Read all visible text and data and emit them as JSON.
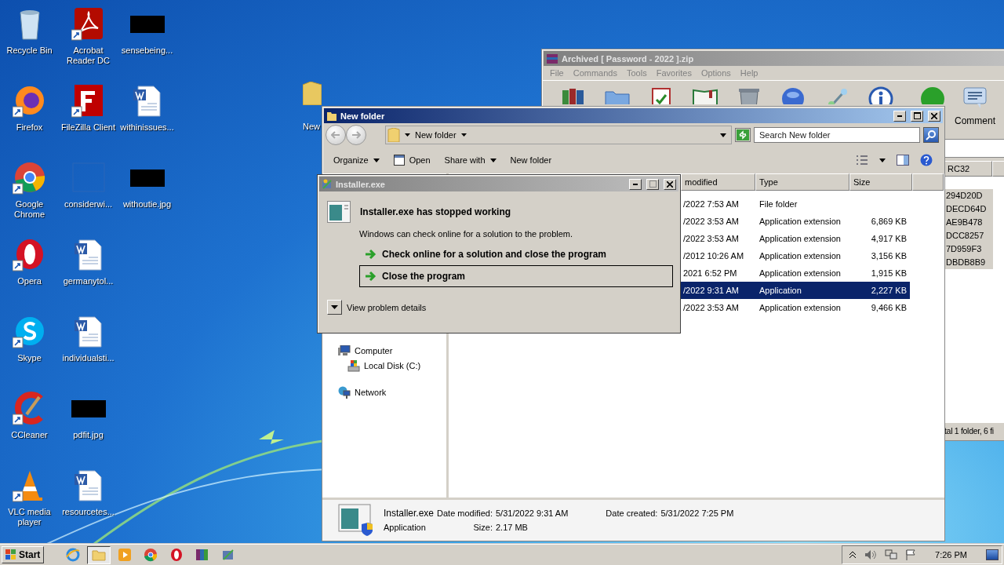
{
  "desktop": {
    "columns": [
      [
        {
          "label": "Recycle Bin",
          "kind": "recycle",
          "shortcut": false
        },
        {
          "label": "Firefox",
          "kind": "firefox",
          "shortcut": true
        },
        {
          "label": "Google Chrome",
          "kind": "chrome",
          "shortcut": true
        },
        {
          "label": "Opera",
          "kind": "opera",
          "shortcut": true
        },
        {
          "label": "Skype",
          "kind": "skype",
          "shortcut": true
        },
        {
          "label": "CCleaner",
          "kind": "ccleaner",
          "shortcut": true
        },
        {
          "label": "VLC media player",
          "kind": "vlc",
          "shortcut": true
        }
      ],
      [
        {
          "label": "Acrobat Reader DC",
          "kind": "acrobat",
          "shortcut": true
        },
        {
          "label": "FileZilla Client",
          "kind": "filezilla",
          "shortcut": true
        },
        {
          "label": "considerwi...",
          "kind": "blank",
          "shortcut": false
        },
        {
          "label": "germanytol...",
          "kind": "word",
          "shortcut": false
        },
        {
          "label": "individualsti...",
          "kind": "word",
          "shortcut": false
        },
        {
          "label": "pdfit.jpg",
          "kind": "redacted",
          "shortcut": false
        },
        {
          "label": "resourcetes...",
          "kind": "word",
          "shortcut": false
        }
      ],
      [
        {
          "label": "sensebeing...",
          "kind": "redacted",
          "shortcut": false
        },
        {
          "label": "withinissues...",
          "kind": "word",
          "shortcut": false
        },
        {
          "label": "withoutie.jpg",
          "kind": "redacted",
          "shortcut": false
        }
      ]
    ],
    "partial_icon": {
      "label": "New",
      "kind": "folder"
    }
  },
  "winrar": {
    "title": "Archived [ Password - 2022 ].zip",
    "menu": [
      "File",
      "Commands",
      "Tools",
      "Favorites",
      "Options",
      "Help"
    ],
    "toolbar": [
      {
        "kind": "add"
      },
      {
        "kind": "extract"
      },
      {
        "kind": "test"
      },
      {
        "kind": "view"
      },
      {
        "kind": "delete"
      },
      {
        "kind": "find"
      },
      {
        "kind": "wizard"
      },
      {
        "kind": "info"
      },
      {
        "kind": "scan"
      },
      {
        "kind": "comment",
        "label": "Comment"
      }
    ],
    "column_header": "RC32",
    "rows": [
      {
        "value": "294D20D",
        "selected": true
      },
      {
        "value": "DECD64D",
        "selected": true
      },
      {
        "value": "AE9B478",
        "selected": true
      },
      {
        "value": "DCC8257",
        "selected": true
      },
      {
        "value": "7D959F3",
        "selected": true
      },
      {
        "value": "DBDB8B9",
        "selected": true
      }
    ],
    "status": "tal 1 folder, 6 fi"
  },
  "explorer": {
    "title": "New folder",
    "breadcrumb": "New folder",
    "search": {
      "placeholder": "Search New folder"
    },
    "toolbar": [
      {
        "label": "Organize",
        "kind": "menu"
      },
      {
        "label": "Open",
        "kind": "open"
      },
      {
        "label": "Share with",
        "kind": "menu"
      },
      {
        "label": "New folder",
        "kind": "plain"
      }
    ],
    "columns": [
      "modified",
      "Type",
      "Size"
    ],
    "rows": [
      {
        "modified": "/2022 7:53 AM",
        "type": "File folder",
        "selected": false
      },
      {
        "modified": "/2022 3:53 AM",
        "type": "Application extension",
        "size": "6,869 KB",
        "selected": false
      },
      {
        "modified": "/2022 3:53 AM",
        "type": "Application extension",
        "size": "4,917 KB",
        "selected": false
      },
      {
        "modified": "/2012 10:26 AM",
        "type": "Application extension",
        "size": "3,156 KB",
        "selected": false
      },
      {
        "modified": "2021 6:52 PM",
        "type": "Application extension",
        "size": "1,915 KB",
        "selected": false
      },
      {
        "modified": "/2022 9:31 AM",
        "type": "Application",
        "size": "2,227 KB",
        "selected": true
      },
      {
        "modified": "/2022 3:53 AM",
        "type": "Application extension",
        "size": "9,466 KB",
        "selected": false
      }
    ],
    "nav": [
      {
        "label": "Computer",
        "kind": "computer",
        "children": [
          {
            "label": "Local Disk (C:)",
            "kind": "disk"
          }
        ]
      },
      {
        "label": "Network",
        "kind": "network"
      }
    ],
    "details": {
      "name": "Installer.exe",
      "type": "Application",
      "fields": [
        {
          "label": "Date modified:",
          "value": "5/31/2022 9:31 AM"
        },
        {
          "label": "Date created:",
          "value": "5/31/2022 7:25 PM"
        },
        {
          "label": "Size:",
          "value": "2.17 MB"
        }
      ]
    }
  },
  "dialog": {
    "title": "Installer.exe",
    "heading": "Installer.exe has stopped working",
    "message": "Windows can check online for a solution to the problem.",
    "options": [
      {
        "label": "Check online for a solution and close the program",
        "focused": false
      },
      {
        "label": "Close the program",
        "focused": true
      }
    ],
    "details_toggle": "View problem details"
  },
  "taskbar": {
    "start": "Start",
    "apps": [
      {
        "kind": "ie",
        "active": false
      },
      {
        "kind": "folder",
        "active": true
      },
      {
        "kind": "media",
        "active": false
      },
      {
        "kind": "chrome",
        "active": false
      },
      {
        "kind": "opera",
        "active": false
      },
      {
        "kind": "winrar",
        "active": false
      },
      {
        "kind": "installer",
        "active": false
      }
    ],
    "clock": "7:26 PM"
  }
}
